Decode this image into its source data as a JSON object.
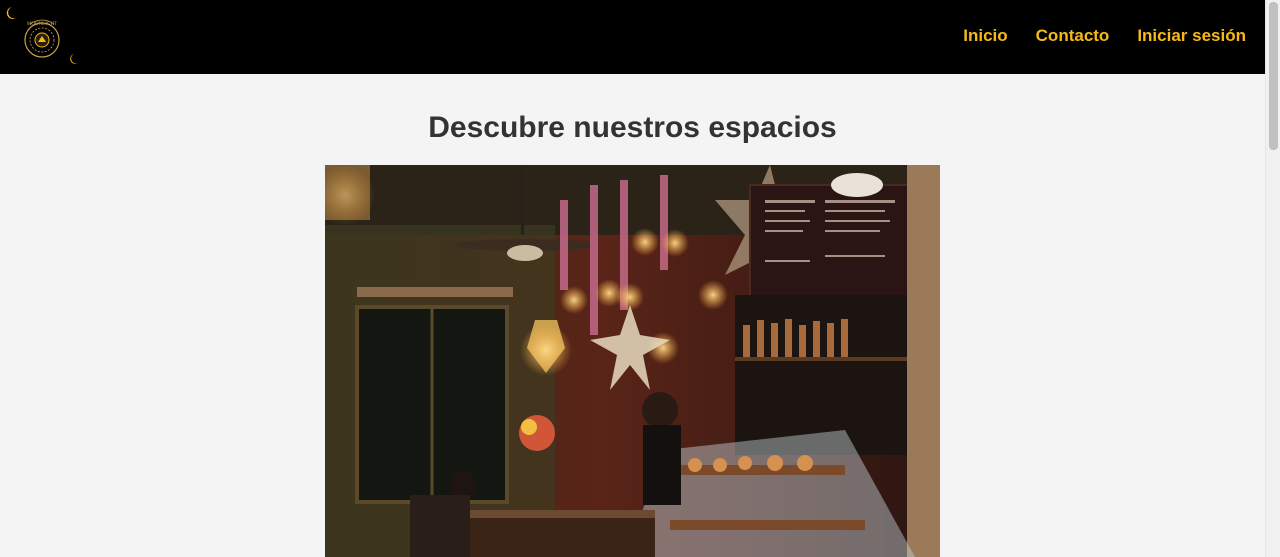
{
  "header": {
    "logo_text": "MOONLIGHT",
    "nav": [
      {
        "label": "Inicio"
      },
      {
        "label": "Contacto"
      },
      {
        "label": "Iniciar sesión"
      }
    ]
  },
  "main": {
    "title": "Descubre nuestros espacios"
  },
  "colors": {
    "nav_background": "#000000",
    "nav_link": "#f6b91a",
    "page_background": "#f4f4f4",
    "title": "#333333"
  },
  "icons": {
    "logo": "moon-emblem-icon",
    "decoration": "crescent-moon-icon"
  }
}
